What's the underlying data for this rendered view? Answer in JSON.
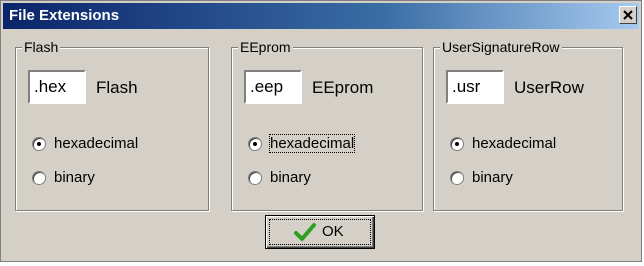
{
  "window": {
    "title": "File Extensions",
    "close_glyph": "close-icon"
  },
  "groups": [
    {
      "legend": "Flash",
      "extension_value": ".hex",
      "extension_label": "Flash",
      "options": [
        "hexadecimal",
        "binary"
      ],
      "selected": "hexadecimal"
    },
    {
      "legend": "EEprom",
      "extension_value": ".eep",
      "extension_label": "EEprom",
      "options": [
        "hexadecimal",
        "binary"
      ],
      "selected": "hexadecimal"
    },
    {
      "legend": "UserSignatureRow",
      "extension_value": ".usr",
      "extension_label": "UserRow",
      "options": [
        "hexadecimal",
        "binary"
      ],
      "selected": "hexadecimal"
    }
  ],
  "ok_button": {
    "label": "OK",
    "icon": "checkmark-icon"
  },
  "colors": {
    "titlebar_start": "#0a246a",
    "titlebar_end": "#a6caf0",
    "dialog_background": "#d4d0c8",
    "checkmark": "#2e9e1f"
  }
}
